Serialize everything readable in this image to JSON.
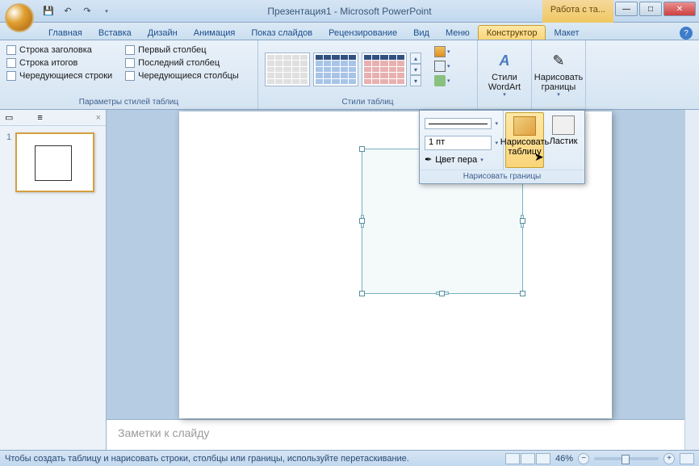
{
  "title": "Презентация1 - Microsoft PowerPoint",
  "context_tab": "Работа с та...",
  "tabs": [
    "Главная",
    "Вставка",
    "Дизайн",
    "Анимация",
    "Показ слайдов",
    "Рецензирование",
    "Вид",
    "Меню",
    "Конструктор",
    "Макет"
  ],
  "active_tab": "Конструктор",
  "ribbon": {
    "group1": {
      "label": "Параметры стилей таблиц",
      "col1": [
        "Строка заголовка",
        "Строка итогов",
        "Чередующиеся строки"
      ],
      "col2": [
        "Первый столбец",
        "Последний столбец",
        "Чередующиеся столбцы"
      ]
    },
    "group2": {
      "label": "Стили таблиц"
    },
    "group3": {
      "wordart": "Стили WordArt",
      "draw": "Нарисовать границы"
    }
  },
  "dropdown": {
    "width_value": "1 пт",
    "pen_color": "Цвет пера",
    "draw_table": "Нарисовать таблицу",
    "eraser": "Ластик",
    "label": "Нарисовать границы"
  },
  "thumb_num": "1",
  "notes_placeholder": "Заметки к слайду",
  "status_text": "Чтобы создать таблицу и нарисовать строки, столбцы или границы, используйте перетаскивание.",
  "zoom": "46%"
}
